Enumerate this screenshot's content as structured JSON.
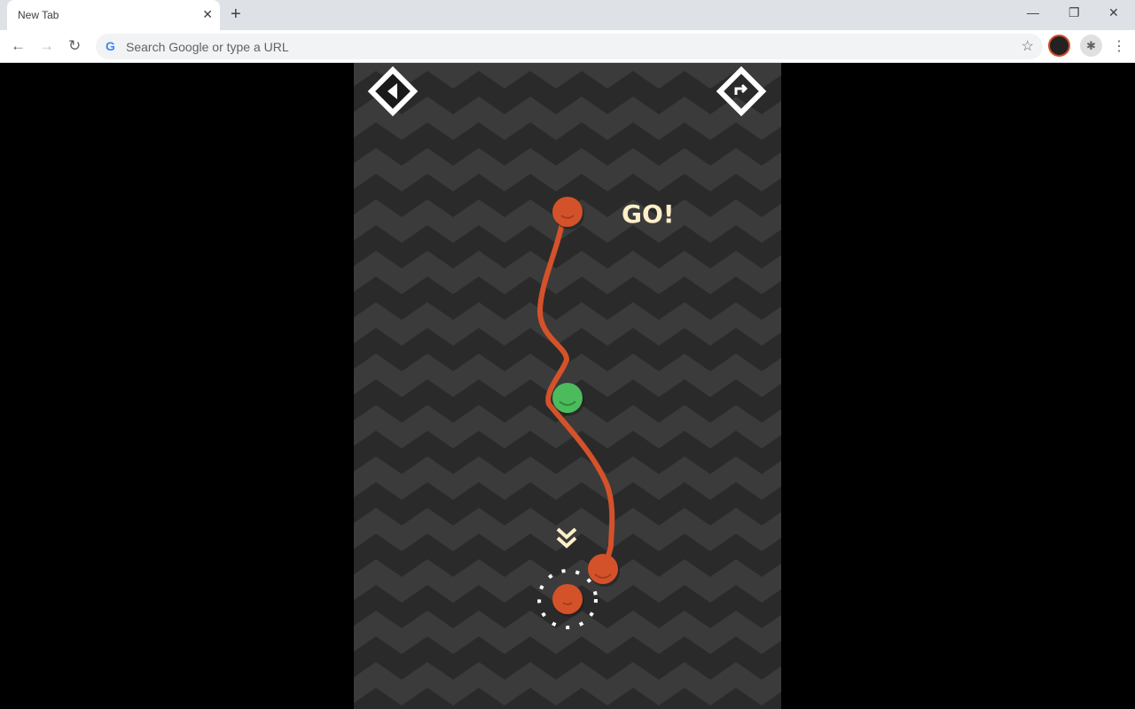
{
  "browser": {
    "tab_title": "New Tab",
    "omnibox_placeholder": "Search Google or type a URL"
  },
  "game": {
    "status_text": "GO!",
    "colors": {
      "ball": "#d4522a",
      "goal": "#4cbb5c",
      "bg_dark": "#2a2a2a",
      "bg_light": "#3b3b3b",
      "text": "#fdefc8"
    },
    "icons": [
      "back-diamond-icon",
      "restart-diamond-icon",
      "double-chevron-down-icon"
    ]
  }
}
